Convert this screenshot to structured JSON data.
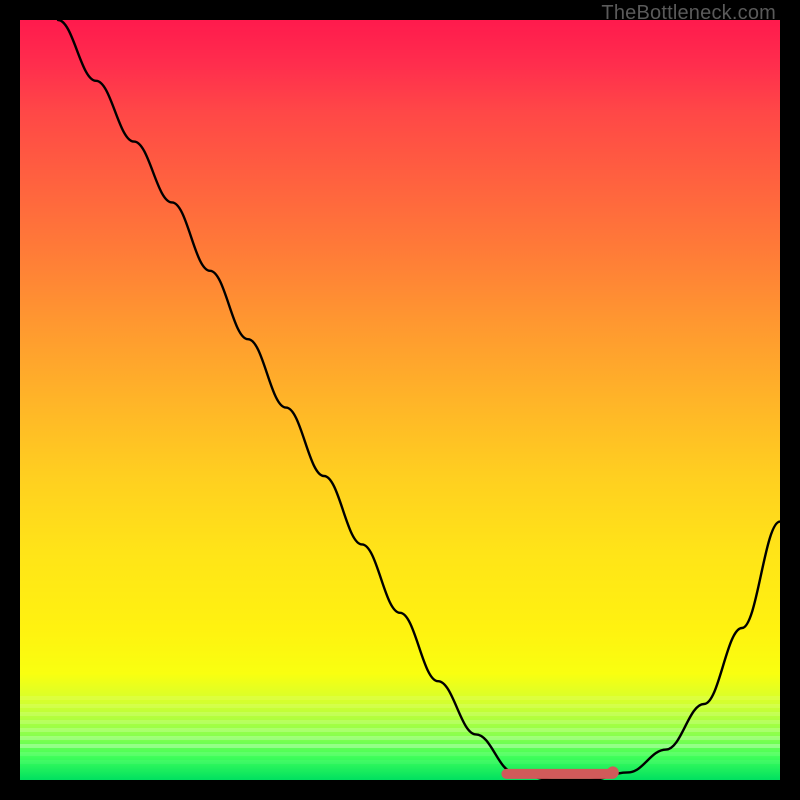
{
  "watermark": "TheBottleneck.com",
  "chart_data": {
    "type": "line",
    "title": "",
    "xlabel": "",
    "ylabel": "",
    "xlim": [
      0,
      100
    ],
    "ylim": [
      0,
      100
    ],
    "grid": false,
    "legend": false,
    "background": "rainbow-gradient red(top) to green(bottom)",
    "series": [
      {
        "name": "bottleneck-curve",
        "color": "#000000",
        "x": [
          5,
          10,
          15,
          20,
          25,
          30,
          35,
          40,
          45,
          50,
          55,
          60,
          65,
          70,
          75,
          80,
          85,
          90,
          95,
          100
        ],
        "values": [
          100,
          92,
          84,
          76,
          67,
          58,
          49,
          40,
          31,
          22,
          13,
          6,
          1,
          0,
          0,
          1,
          4,
          10,
          20,
          34
        ]
      }
    ],
    "annotations": [
      {
        "name": "optimal-range-marker",
        "type": "segment",
        "color": "#d05a5a",
        "x_start": 64,
        "x_end": 78,
        "y": 0.8
      },
      {
        "name": "optimal-point-marker",
        "type": "point",
        "color": "#d05a5a",
        "x": 78,
        "y": 1.0
      }
    ]
  }
}
